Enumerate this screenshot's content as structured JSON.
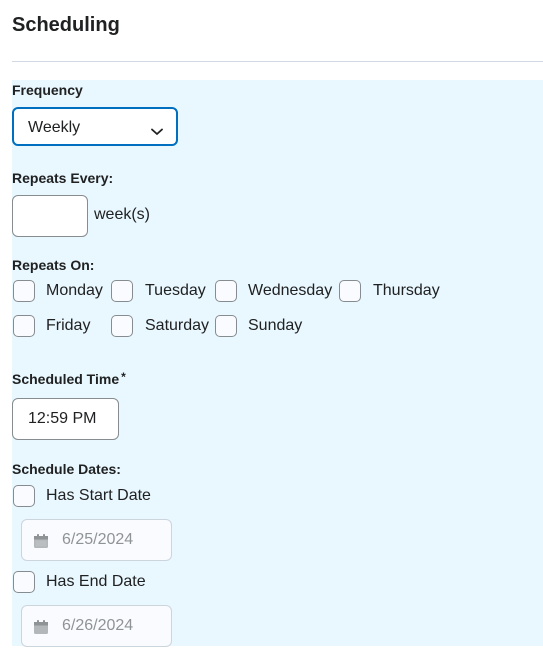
{
  "title": "Scheduling",
  "frequency": {
    "label": "Frequency",
    "selected": "Weekly"
  },
  "repeats_every": {
    "label": "Repeats Every:",
    "value": "",
    "unit": "week(s)"
  },
  "repeats_on": {
    "label": "Repeats On:",
    "days": [
      {
        "label": "Monday",
        "checked": false
      },
      {
        "label": "Tuesday",
        "checked": false
      },
      {
        "label": "Wednesday",
        "checked": false
      },
      {
        "label": "Thursday",
        "checked": false
      },
      {
        "label": "Friday",
        "checked": false
      },
      {
        "label": "Saturday",
        "checked": false
      },
      {
        "label": "Sunday",
        "checked": false
      }
    ]
  },
  "scheduled_time": {
    "label": "Scheduled Time",
    "required_marker": "*",
    "value": "12:59 PM"
  },
  "schedule_dates": {
    "label": "Schedule Dates:",
    "start": {
      "label": "Has Start Date",
      "checked": false,
      "date": "6/25/2024"
    },
    "end": {
      "label": "Has End Date",
      "checked": false,
      "date": "6/26/2024"
    }
  },
  "colors": {
    "panel_bg": "#e9f8fe",
    "focus_border": "#006fbf",
    "text": "#202122",
    "disabled_text": "#909396"
  },
  "icons": {
    "dropdown": "chevron-down-icon",
    "date": "calendar-icon"
  }
}
